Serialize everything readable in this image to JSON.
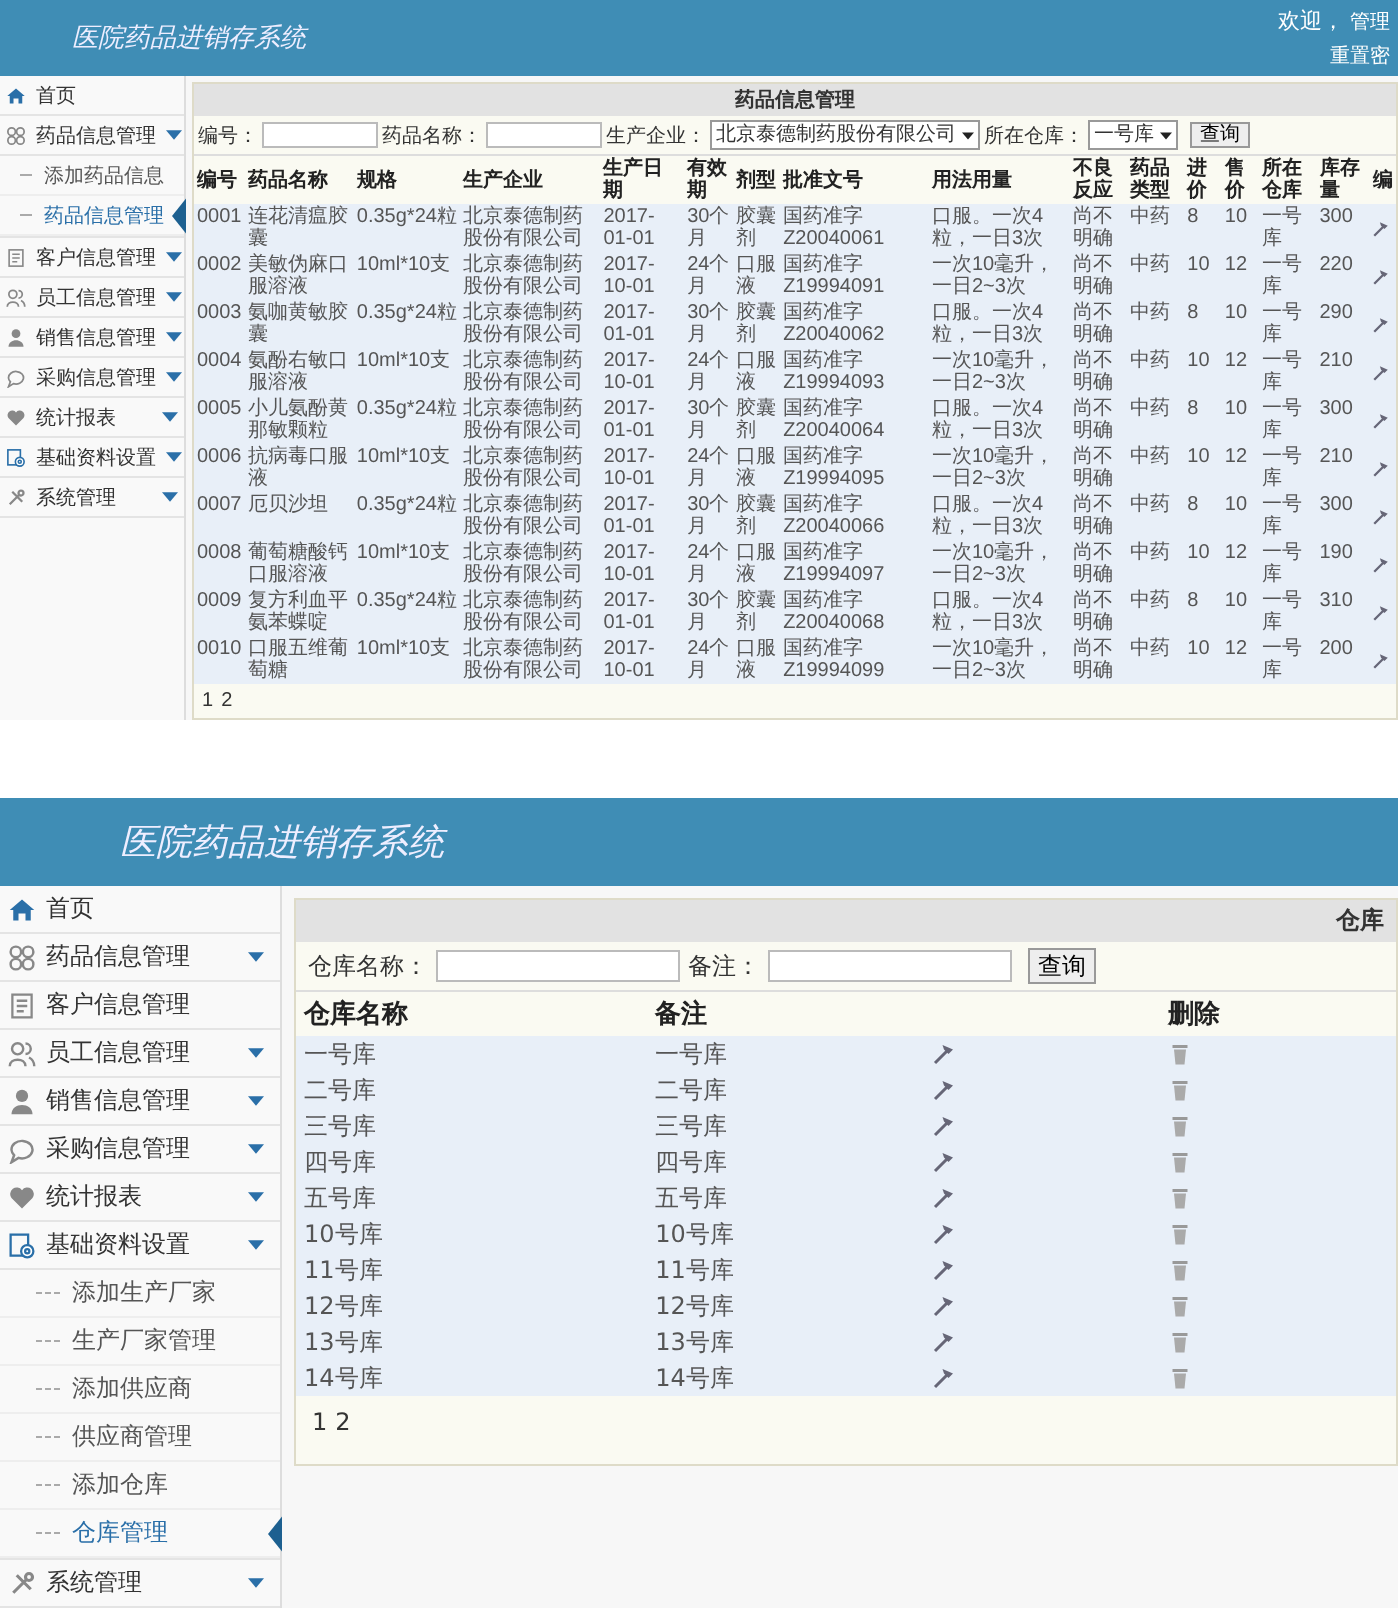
{
  "screens": [
    {
      "header": {
        "title": "医院药品进销存系统",
        "welcome": {
          "greeting": "欢迎，",
          "user": "管理",
          "links": [
            "重置密"
          ]
        }
      },
      "sidebar": [
        {
          "label": "首页",
          "dropdown": false,
          "selected": false
        },
        {
          "label": "药品信息管理",
          "dropdown": true,
          "selected": false,
          "children": [
            {
              "label": "添加药品信息",
              "selected": false
            },
            {
              "label": "药品信息管理",
              "selected": true
            }
          ]
        },
        {
          "label": "客户信息管理",
          "dropdown": true,
          "selected": false
        },
        {
          "label": "员工信息管理",
          "dropdown": true,
          "selected": false
        },
        {
          "label": "销售信息管理",
          "dropdown": true,
          "selected": false
        },
        {
          "label": "采购信息管理",
          "dropdown": true,
          "selected": false
        },
        {
          "label": "统计报表",
          "dropdown": true,
          "selected": false
        },
        {
          "label": "基础资料设置",
          "dropdown": true,
          "selected": false
        },
        {
          "label": "系统管理",
          "dropdown": true,
          "selected": false
        }
      ],
      "panel": {
        "title": "药品信息管理",
        "filters": [
          {
            "label": "编号：",
            "kind": "text"
          },
          {
            "label": "药品名称：",
            "kind": "text"
          },
          {
            "label": "生产企业：",
            "kind": "select",
            "value": "北京泰德制药股份有限公司"
          },
          {
            "label": "所在仓库：",
            "kind": "select",
            "value": "一号库"
          }
        ],
        "button": "查询",
        "columns": [
          {
            "label": "编号",
            "kind": "text"
          },
          {
            "label": "药品名称",
            "kind": "text"
          },
          {
            "label": "规格",
            "kind": "text"
          },
          {
            "label": "生产企业",
            "kind": "text"
          },
          {
            "label": "生产日期",
            "kind": "text"
          },
          {
            "label": "有效期",
            "kind": "text"
          },
          {
            "label": "剂型",
            "kind": "text"
          },
          {
            "label": "批准文号",
            "kind": "text"
          },
          {
            "label": "用法用量",
            "kind": "text"
          },
          {
            "label": "不良反应",
            "kind": "text"
          },
          {
            "label": "药品类型",
            "kind": "text"
          },
          {
            "label": "进价",
            "kind": "text"
          },
          {
            "label": "售价",
            "kind": "text"
          },
          {
            "label": "所在仓库",
            "kind": "text"
          },
          {
            "label": "库存量",
            "kind": "text"
          },
          {
            "label": "编",
            "kind": "edit"
          }
        ],
        "rows": [
          [
            "0001",
            "连花清瘟胶囊",
            "0.35g*24粒",
            "北京泰德制药股份有限公司",
            "2017-01-01",
            "30个月",
            "胶囊剂",
            "国药准字Z20040061",
            "口服。一次4粒，一日3次",
            "尚不明确",
            "中药",
            "8",
            "10",
            "一号库",
            "300"
          ],
          [
            "0002",
            "美敏伪麻口服溶液",
            "10ml*10支",
            "北京泰德制药股份有限公司",
            "2017-10-01",
            "24个月",
            "口服液",
            "国药准字Z19994091",
            "一次10毫升，一日2~3次",
            "尚不明确",
            "中药",
            "10",
            "12",
            "一号库",
            "220"
          ],
          [
            "0003",
            "氨咖黄敏胶囊",
            "0.35g*24粒",
            "北京泰德制药股份有限公司",
            "2017-01-01",
            "30个月",
            "胶囊剂",
            "国药准字Z20040062",
            "口服。一次4粒，一日3次",
            "尚不明确",
            "中药",
            "8",
            "10",
            "一号库",
            "290"
          ],
          [
            "0004",
            "氨酚右敏口服溶液",
            "10ml*10支",
            "北京泰德制药股份有限公司",
            "2017-10-01",
            "24个月",
            "口服液",
            "国药准字Z19994093",
            "一次10毫升，一日2~3次",
            "尚不明确",
            "中药",
            "10",
            "12",
            "一号库",
            "210"
          ],
          [
            "0005",
            "小儿氨酚黄那敏颗粒",
            "0.35g*24粒",
            "北京泰德制药股份有限公司",
            "2017-01-01",
            "30个月",
            "胶囊剂",
            "国药准字Z20040064",
            "口服。一次4粒，一日3次",
            "尚不明确",
            "中药",
            "8",
            "10",
            "一号库",
            "300"
          ],
          [
            "0006",
            "抗病毒口服液",
            "10ml*10支",
            "北京泰德制药股份有限公司",
            "2017-10-01",
            "24个月",
            "口服液",
            "国药准字Z19994095",
            "一次10毫升，一日2~3次",
            "尚不明确",
            "中药",
            "10",
            "12",
            "一号库",
            "210"
          ],
          [
            "0007",
            "厄贝沙坦",
            "0.35g*24粒",
            "北京泰德制药股份有限公司",
            "2017-01-01",
            "30个月",
            "胶囊剂",
            "国药准字Z20040066",
            "口服。一次4粒，一日3次",
            "尚不明确",
            "中药",
            "8",
            "10",
            "一号库",
            "300"
          ],
          [
            "0008",
            "葡萄糖酸钙口服溶液",
            "10ml*10支",
            "北京泰德制药股份有限公司",
            "2017-10-01",
            "24个月",
            "口服液",
            "国药准字Z19994097",
            "一次10毫升，一日2~3次",
            "尚不明确",
            "中药",
            "10",
            "12",
            "一号库",
            "190"
          ],
          [
            "0009",
            "复方利血平氨苯蝶啶",
            "0.35g*24粒",
            "北京泰德制药股份有限公司",
            "2017-01-01",
            "30个月",
            "胶囊剂",
            "国药准字Z20040068",
            "口服。一次4粒，一日3次",
            "尚不明确",
            "中药",
            "8",
            "10",
            "一号库",
            "310"
          ],
          [
            "0010",
            "口服五维葡萄糖",
            "10ml*10支",
            "北京泰德制药股份有限公司",
            "2017-10-01",
            "24个月",
            "口服液",
            "国药准字Z19994099",
            "一次10毫升，一日2~3次",
            "尚不明确",
            "中药",
            "10",
            "12",
            "一号库",
            "200"
          ]
        ],
        "pages": [
          "1",
          "2"
        ]
      }
    },
    {
      "header": {
        "title": "医院药品进销存系统"
      },
      "sidebar": [
        {
          "label": "首页",
          "dropdown": false,
          "selected": false
        },
        {
          "label": "药品信息管理",
          "dropdown": true,
          "selected": false
        },
        {
          "label": "客户信息管理",
          "dropdown": false,
          "selected": false
        },
        {
          "label": "员工信息管理",
          "dropdown": true,
          "selected": false
        },
        {
          "label": "销售信息管理",
          "dropdown": true,
          "selected": false
        },
        {
          "label": "采购信息管理",
          "dropdown": true,
          "selected": false
        },
        {
          "label": "统计报表",
          "dropdown": true,
          "selected": false
        },
        {
          "label": "基础资料设置",
          "dropdown": true,
          "selected": false,
          "children": [
            {
              "label": "添加生产厂家",
              "selected": false
            },
            {
              "label": "生产厂家管理",
              "selected": false
            },
            {
              "label": "添加供应商",
              "selected": false
            },
            {
              "label": "供应商管理",
              "selected": false
            },
            {
              "label": "添加仓库",
              "selected": false
            },
            {
              "label": "仓库管理",
              "selected": true
            }
          ]
        },
        {
          "label": "系统管理",
          "dropdown": true,
          "selected": false
        }
      ],
      "panel": {
        "title": "仓库",
        "filters": [
          {
            "label": "仓库名称：",
            "kind": "text"
          },
          {
            "label": "备注：",
            "kind": "text"
          }
        ],
        "button": "查询",
        "columns": [
          {
            "label": "仓库名称",
            "kind": "text"
          },
          {
            "label": "备注",
            "kind": "text"
          },
          {
            "kind": "edit"
          },
          {
            "label": "删除",
            "kind": "delete"
          }
        ],
        "rows": [
          [
            "一号库",
            "一号库"
          ],
          [
            "二号库",
            "二号库"
          ],
          [
            "三号库",
            "三号库"
          ],
          [
            "四号库",
            "四号库"
          ],
          [
            "五号库",
            "五号库"
          ],
          [
            "10号库",
            "10号库"
          ],
          [
            "11号库",
            "11号库"
          ],
          [
            "12号库",
            "12号库"
          ],
          [
            "13号库",
            "13号库"
          ],
          [
            "14号库",
            "14号库"
          ]
        ],
        "pages": [
          "1",
          "2"
        ]
      }
    }
  ]
}
